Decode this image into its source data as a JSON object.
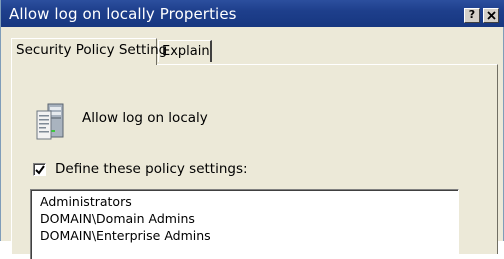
{
  "window": {
    "title": "Allow log on locally Properties",
    "help_button": "?",
    "close_button": "close"
  },
  "tabs": [
    {
      "label": "Security Policy Setting",
      "active": true
    },
    {
      "label": "Explain",
      "active": false
    }
  ],
  "policy": {
    "icon": "server-policy-icon",
    "name": "Allow log on localy"
  },
  "define_settings": {
    "label": "Define these policy settings:",
    "checked": true
  },
  "accounts": [
    "Administrators",
    "DOMAIN\\Domain Admins",
    "DOMAIN\\Enterprise Admins"
  ],
  "colors": {
    "titlebar": "#1e3f8c",
    "dialog_bg": "#ece9d8"
  }
}
